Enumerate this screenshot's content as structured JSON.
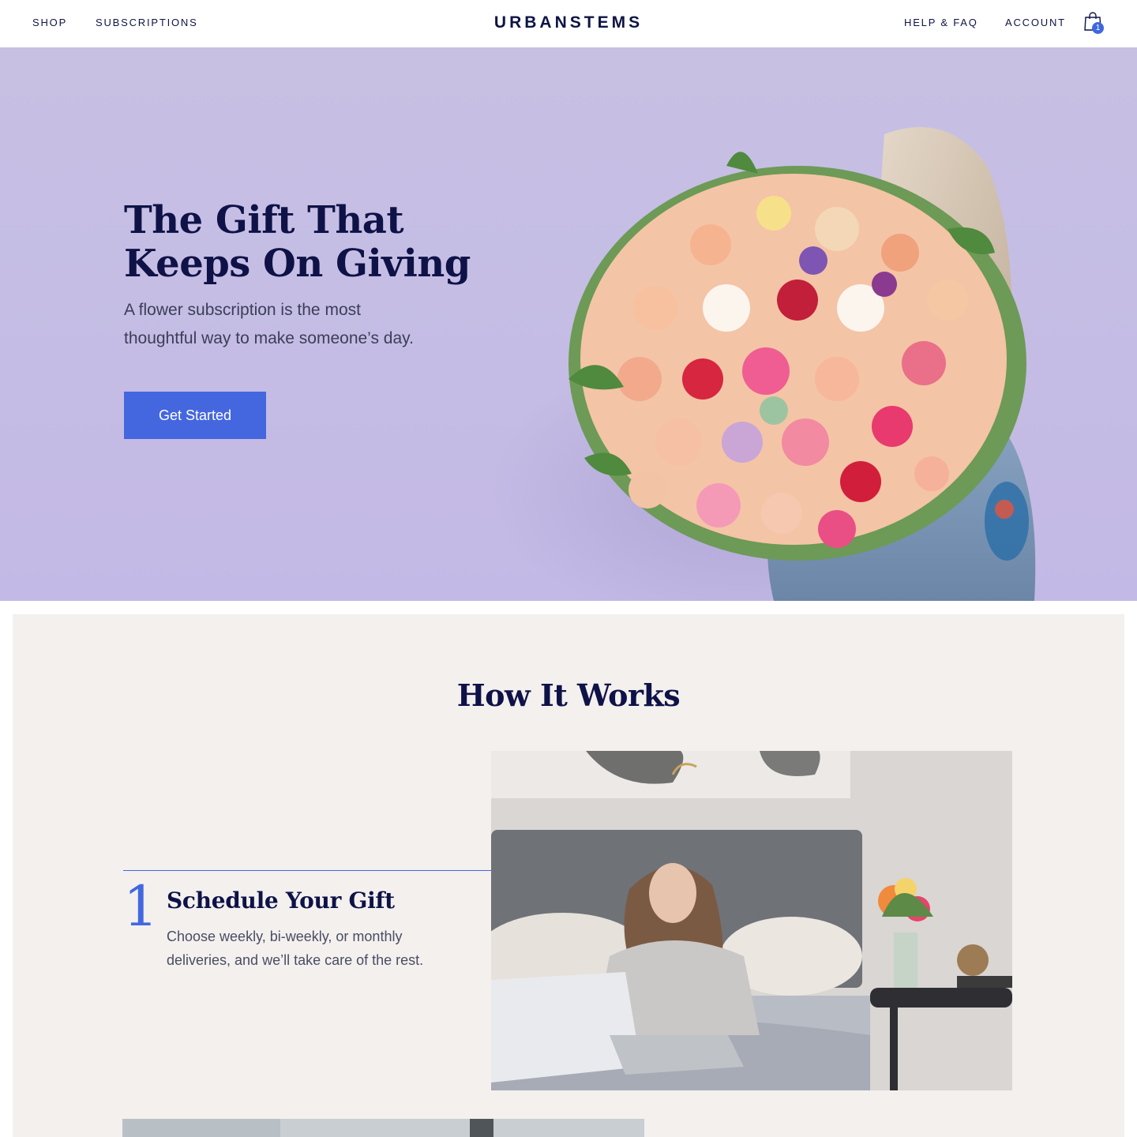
{
  "nav": {
    "shop": "SHOP",
    "subscriptions": "SUBSCRIPTIONS",
    "logo": "URBANSTEMS",
    "help": "HELP & FAQ",
    "account": "ACCOUNT",
    "cart_count": "1",
    "cart_icon": "shopping-bag-icon"
  },
  "hero": {
    "title_line1": "The Gift That",
    "title_line2": "Keeps On Giving",
    "subtitle_line1": "A flower subscription is the most",
    "subtitle_line2": "thoughtful way to make someone’s day.",
    "cta": "Get Started",
    "background_color": "#c6bfe4",
    "button_color": "#4467e0"
  },
  "how": {
    "title": "How It Works",
    "steps": [
      {
        "number": "1",
        "title": "Schedule Your Gift",
        "text_line1": "Choose weekly, bi-weekly, or monthly",
        "text_line2": "deliveries, and we’ll take care of the rest."
      }
    ],
    "background_color": "#f3f0ee"
  }
}
